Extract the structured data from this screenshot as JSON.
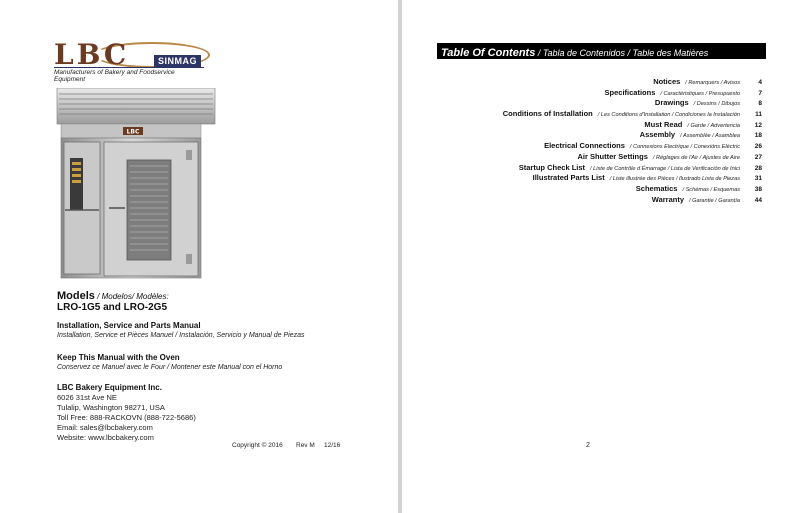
{
  "left": {
    "logo_text": "LBC",
    "logo_badge": "SINMAG",
    "tagline": "Manufacturers of Bakery and Foodservice Equipment",
    "oven_panel_logo": "LBC",
    "models_label": "Models",
    "models_translations": " / Modelos/ Modèles:",
    "model_names": "LRO-1G5 and LRO-2G5",
    "manual_title": "Installation, Service and Parts Manual",
    "manual_title_translations": "Installation, Service et Pièces Manuel / Instalación, Servicio y Manual de Piezas",
    "keep_title": "Keep This Manual with the Oven",
    "keep_translations": "Conservez ce Manuel avec le Four / Montener este Manual con el Horno",
    "company": "LBC Bakery Equipment Inc.",
    "address_lines": [
      "6026 31st Ave NE",
      "Tulalip, Washington 98271, USA",
      "Toll Free: 888-RACKOVN (888-722-5686)",
      "Email:  sales@lbcbakery.com",
      "Website:  www.lbcbakery.com"
    ],
    "copyright": "Copyright © 2016",
    "revision": "Rev M",
    "date": "12/16"
  },
  "right": {
    "toc_title": "Table Of Contents",
    "toc_title_translations": " / Tabla de Contenidos / Table des Matières",
    "entries": [
      {
        "en": "Notices",
        "tr": "/ Remarquers / Avisos",
        "page": "4"
      },
      {
        "en": "Specifications",
        "tr": "/ Caractéristiques / Presupuesto",
        "page": "7"
      },
      {
        "en": "Drawings",
        "tr": "/ Dessins / Dibujos",
        "page": "8"
      },
      {
        "en": "Conditions of Installation",
        "tr": "/ Les Conditions d'Installation / Condiciones la Instalación",
        "page": "11"
      },
      {
        "en": "Must Read",
        "tr": "/ Garde / Advertencia",
        "page": "12"
      },
      {
        "en": "Assembly",
        "tr": "/ Assemblée / Asamblea",
        "page": "18"
      },
      {
        "en": "Electrical Connections",
        "tr": "/ Connexions Electrique / Conexións Eléctric",
        "page": "26"
      },
      {
        "en": "Air Shutter Settings",
        "tr": "/ Réglages de l'Air / Ajustes de Aire",
        "page": "27"
      },
      {
        "en": "Startup Check List",
        "tr": "/ Liste de Contrôle d Émarrage / Lista de Verificación de Inici",
        "page": "28"
      },
      {
        "en": "Illustrated Parts List",
        "tr": "/ Liste illustrée des Pièces / Ilustrado Lista de Piezas",
        "page": "31"
      },
      {
        "en": "Schematics",
        "tr": "/ Schémas / Esquemas",
        "page": "38"
      },
      {
        "en": "Warranty",
        "tr": "/ Garantie / Garantía",
        "page": "44"
      }
    ],
    "page_number": "2"
  }
}
